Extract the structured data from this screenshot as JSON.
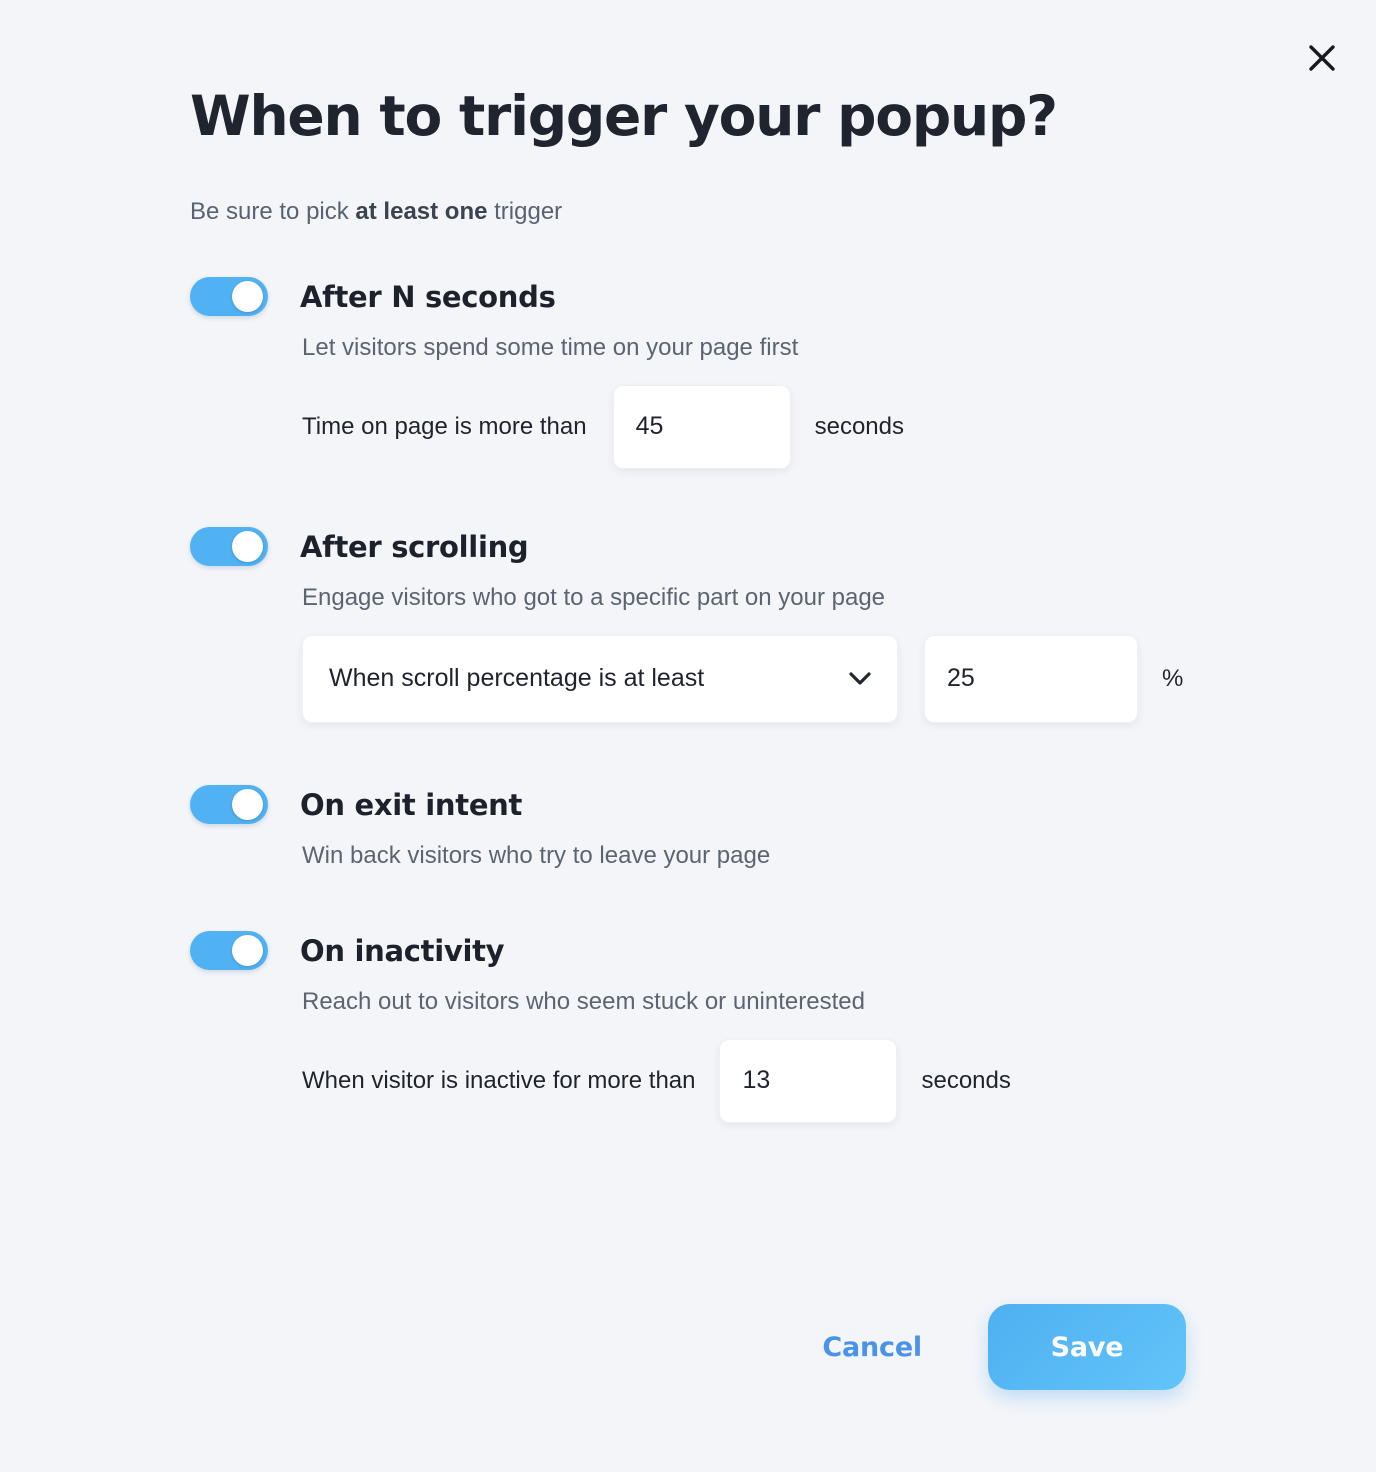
{
  "dialog": {
    "title": "When to trigger your popup?",
    "subtitle_prefix": "Be sure to pick ",
    "subtitle_strong": "at least one",
    "subtitle_suffix": " trigger",
    "close_icon": "close-icon"
  },
  "triggers": [
    {
      "id": "after-n-seconds",
      "title": "After N seconds",
      "description": "Let visitors spend some time on your page first",
      "enabled": true,
      "row": {
        "label": "Time on page is more than",
        "value": "45",
        "suffix": "seconds"
      }
    },
    {
      "id": "after-scrolling",
      "title": "After scrolling",
      "description": "Engage visitors who got to a specific part on your page",
      "enabled": true,
      "select": {
        "value": "When scroll percentage is at least",
        "icon": "chevron-down-icon"
      },
      "row": {
        "value": "25",
        "suffix": "%"
      }
    },
    {
      "id": "on-exit-intent",
      "title": "On exit intent",
      "description": "Win back visitors who try to leave your page",
      "enabled": true
    },
    {
      "id": "on-inactivity",
      "title": "On inactivity",
      "description": "Reach out to visitors who seem stuck or uninterested",
      "enabled": true,
      "row": {
        "label": "When visitor is inactive for more than",
        "value": "13",
        "suffix": "seconds"
      }
    }
  ],
  "footer": {
    "cancel_label": "Cancel",
    "save_label": "Save"
  },
  "colors": {
    "background": "#f4f5f9",
    "accent": "#51b2f3",
    "link": "#4a93e9",
    "title": "#20242e",
    "muted_text": "#5c6472"
  }
}
